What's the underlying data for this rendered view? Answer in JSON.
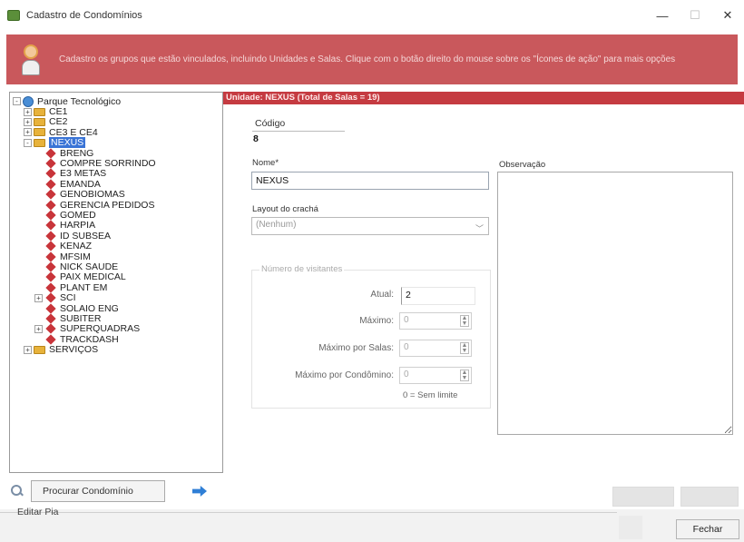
{
  "window": {
    "title": "Cadastro de Condomínios",
    "controls": {
      "minimize": "—",
      "restore": "☐",
      "close": "✕"
    }
  },
  "banner": {
    "text": "Cadastro os grupos que estão vinculados, incluindo Unidades e Salas. Clique com o botão direito do mouse sobre os \"Ícones de ação\" para mais opções"
  },
  "tree": {
    "nodes": [
      {
        "id": "root",
        "label": "Parque Tecnológico",
        "level": 0,
        "kind": "world",
        "expander": "-"
      },
      {
        "id": "ce1",
        "label": "CE1",
        "level": 1,
        "kind": "folder",
        "expander": "+"
      },
      {
        "id": "ce2",
        "label": "CE2",
        "level": 1,
        "kind": "folder",
        "expander": "+"
      },
      {
        "id": "ce3",
        "label": "CE3 E CE4",
        "level": 1,
        "kind": "folder",
        "expander": "+"
      },
      {
        "id": "nexus",
        "label": "NEXUS",
        "level": 1,
        "kind": "folder",
        "expander": "-",
        "selected": true
      },
      {
        "id": "c1",
        "label": "BRENG",
        "level": 2,
        "kind": "item"
      },
      {
        "id": "c2",
        "label": "COMPRE SORRINDO",
        "level": 2,
        "kind": "item"
      },
      {
        "id": "c3",
        "label": "E3 METAS",
        "level": 2,
        "kind": "item"
      },
      {
        "id": "c4",
        "label": "EMANDA",
        "level": 2,
        "kind": "item"
      },
      {
        "id": "c5",
        "label": "GENOBIOMAS",
        "level": 2,
        "kind": "item"
      },
      {
        "id": "c6",
        "label": "GERENCIA PEDIDOS",
        "level": 2,
        "kind": "item"
      },
      {
        "id": "c7",
        "label": "GOMED",
        "level": 2,
        "kind": "item"
      },
      {
        "id": "c8",
        "label": "HARPIA",
        "level": 2,
        "kind": "item"
      },
      {
        "id": "c9",
        "label": "ID SUBSEA",
        "level": 2,
        "kind": "item"
      },
      {
        "id": "c10",
        "label": "KENAZ",
        "level": 2,
        "kind": "item"
      },
      {
        "id": "c11",
        "label": "MFSIM",
        "level": 2,
        "kind": "item"
      },
      {
        "id": "c12",
        "label": "NICK SAUDE",
        "level": 2,
        "kind": "item"
      },
      {
        "id": "c13",
        "label": "PAIX MEDICAL",
        "level": 2,
        "kind": "item"
      },
      {
        "id": "c14",
        "label": "PLANT EM",
        "level": 2,
        "kind": "item"
      },
      {
        "id": "c15",
        "label": "SCI",
        "level": 2,
        "kind": "item",
        "expander": "+"
      },
      {
        "id": "c16",
        "label": "SOLAIO ENG",
        "level": 2,
        "kind": "item"
      },
      {
        "id": "c17",
        "label": "SUBITER",
        "level": 2,
        "kind": "item"
      },
      {
        "id": "c18",
        "label": "SUPERQUADRAS",
        "level": 2,
        "kind": "item",
        "expander": "+"
      },
      {
        "id": "c19",
        "label": "TRACKDASH",
        "level": 2,
        "kind": "item"
      },
      {
        "id": "servicos",
        "label": "SERVIÇOS",
        "level": 1,
        "kind": "folder",
        "expander": "+"
      }
    ]
  },
  "search": {
    "button_label": "Procurar Condomínio"
  },
  "status": {
    "text": "Editar Pia"
  },
  "detail": {
    "header": "Unidade: NEXUS (Total de Salas = 19)",
    "codigo_label": "Código",
    "codigo_value": "8",
    "nome_label": "Nome*",
    "nome_value": "NEXUS",
    "layout_label": "Layout do crachá",
    "layout_value": "(Nenhum)",
    "obs_label": "Observação",
    "group_title": "Número de visitantes",
    "atual_label": "Atual:",
    "atual_value": "2",
    "maximo_label": "Máximo:",
    "maximo_value": "0",
    "max_sala_label": "Máximo por Salas:",
    "max_sala_value": "0",
    "max_cond_label": "Máximo por Condômino:",
    "max_cond_value": "0",
    "hint": "0 = Sem limite"
  },
  "buttons": {
    "fechar": "Fechar"
  }
}
